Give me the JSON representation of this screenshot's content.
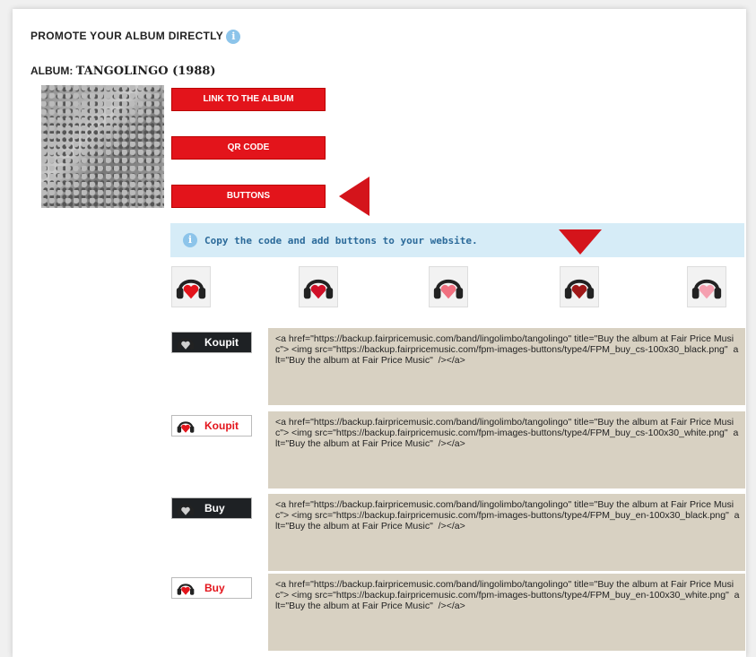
{
  "header": {
    "title": "PROMOTE YOUR ALBUM DIRECTLY",
    "info_glyph": "i"
  },
  "album": {
    "label": "ALBUM:",
    "name": "TANGOLINGO (1988)"
  },
  "actions": {
    "link": "LINK TO THE ALBUM",
    "qr": "QR CODE",
    "buttons": "BUTTONS"
  },
  "info": {
    "text": "Copy the code and add buttons to your website.",
    "glyph": "i"
  },
  "headphone_styles": [
    {
      "icon": "headphones-red-heart-icon",
      "color": "#e3141b"
    },
    {
      "icon": "headphones-broken-heart-icon",
      "color": "#d01028"
    },
    {
      "icon": "headphones-pixel-heart-icon",
      "color": "#f07080"
    },
    {
      "icon": "headphones-real-heart-icon",
      "color": "#a01818"
    },
    {
      "icon": "headphones-outline-heart-icon",
      "color": "#f5a0b0"
    }
  ],
  "buttons": [
    {
      "label": "Koupit",
      "theme": "black",
      "code": "<a href=\"https://backup.fairpricemusic.com/band/lingolimbo/tangolingo\" title=\"Buy the album at Fair Price Music\"> <img src=\"https://backup.fairpricemusic.com/fpm-images-buttons/type4/FPM_buy_cs-100x30_black.png\"  alt=\"Buy the album at Fair Price Music\"  /></a>"
    },
    {
      "label": "Koupit",
      "theme": "white",
      "code": "<a href=\"https://backup.fairpricemusic.com/band/lingolimbo/tangolingo\" title=\"Buy the album at Fair Price Music\"> <img src=\"https://backup.fairpricemusic.com/fpm-images-buttons/type4/FPM_buy_cs-100x30_white.png\"  alt=\"Buy the album at Fair Price Music\"  /></a>"
    },
    {
      "label": "Buy",
      "theme": "black",
      "code": "<a href=\"https://backup.fairpricemusic.com/band/lingolimbo/tangolingo\" title=\"Buy the album at Fair Price Music\"> <img src=\"https://backup.fairpricemusic.com/fpm-images-buttons/type4/FPM_buy_en-100x30_black.png\"  alt=\"Buy the album at Fair Price Music\"  /></a>"
    },
    {
      "label": "Buy",
      "theme": "white",
      "code": "<a href=\"https://backup.fairpricemusic.com/band/lingolimbo/tangolingo\" title=\"Buy the album at Fair Price Music\"> <img src=\"https://backup.fairpricemusic.com/fpm-images-buttons/type4/FPM_buy_en-100x30_white.png\"  alt=\"Buy the album at Fair Price Music\"  /></a>"
    }
  ],
  "colors": {
    "accent": "#e3141b",
    "info_bg": "#d6ecf7",
    "code_bg": "#d8d1c2"
  }
}
